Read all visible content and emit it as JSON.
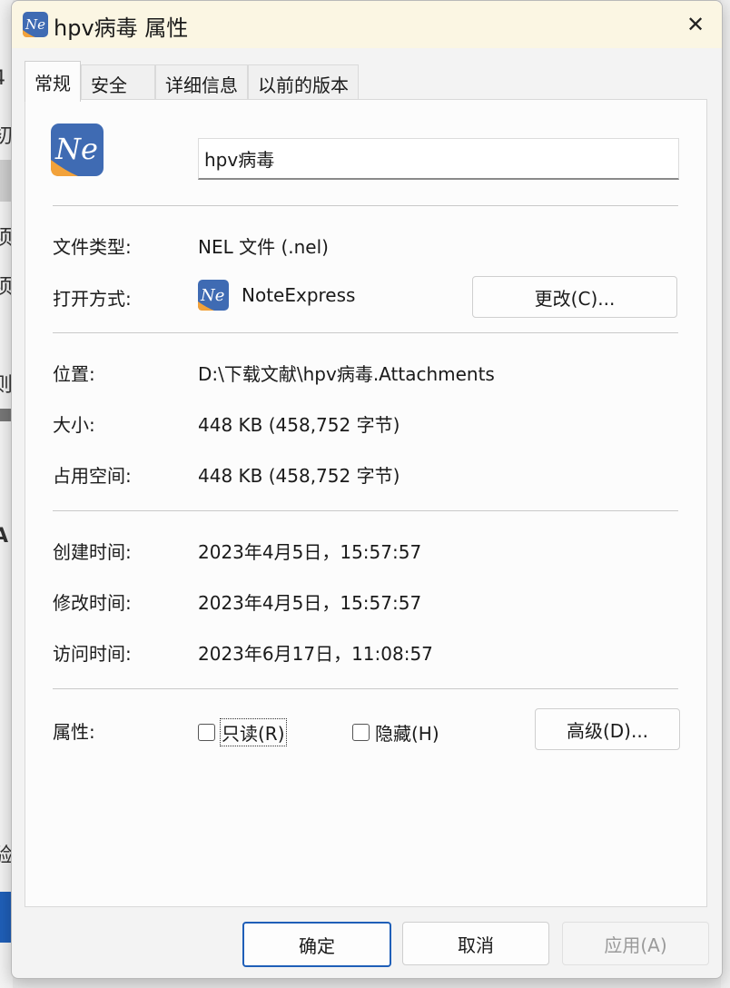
{
  "window": {
    "title": "hpv病毒 属性",
    "close_glyph": "✕"
  },
  "tabs": [
    {
      "label": "常规",
      "active": true
    },
    {
      "label": "安全",
      "active": false
    },
    {
      "label": "详细信息",
      "active": false
    },
    {
      "label": "以前的版本",
      "active": false
    }
  ],
  "general": {
    "file_name": "hpv病毒",
    "file_type_label": "文件类型:",
    "file_type_value": "NEL 文件 (.nel)",
    "open_with_label": "打开方式:",
    "open_with_value": "NoteExpress",
    "change_button": "更改(C)...",
    "location_label": "位置:",
    "location_value": "D:\\下载文献\\hpv病毒.Attachments",
    "size_label": "大小:",
    "size_value": "448 KB (458,752 字节)",
    "size_on_disk_label": "占用空间:",
    "size_on_disk_value": "448 KB (458,752 字节)",
    "created_label": "创建时间:",
    "created_value": "2023年4月5日，15:57:57",
    "modified_label": "修改时间:",
    "modified_value": "2023年4月5日，15:57:57",
    "accessed_label": "访问时间:",
    "accessed_value": "2023年6月17日，11:08:57",
    "attributes_label": "属性:",
    "readonly_label": "只读(R)",
    "hidden_label": "隐藏(H)",
    "advanced_button": "高级(D)..."
  },
  "footer": {
    "ok": "确定",
    "cancel": "取消",
    "apply": "应用(A)"
  },
  "colors": {
    "icon_blue": "#3f6bb3",
    "icon_orange": "#f2a23a",
    "title_bar": "#fbf6e3",
    "primary_border": "#1f5fb8"
  },
  "icons": {
    "app_icon": "noteexpress-ne-icon"
  }
}
